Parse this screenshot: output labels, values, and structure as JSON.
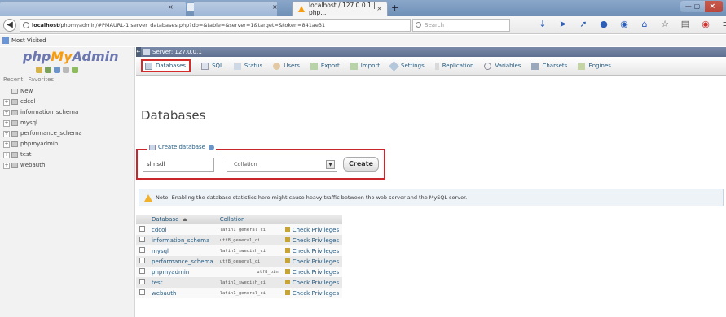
{
  "browser": {
    "active_tab_title": "localhost / 127.0.0.1 | php...",
    "tab_close": "×",
    "new_tab": "+",
    "url_host": "localhost",
    "url_rest": "/phpmyadmin/#PMAURL-1:server_databases.php?db=&table=&server=1&target=&token=841ae31",
    "search_placeholder": "Search",
    "bookmarks_label": "Most Visited",
    "win_close": "×",
    "win_minmax": "— ▢"
  },
  "sidebar": {
    "logo_php": "php",
    "logo_my": "My",
    "logo_admin": "Admin",
    "recent_label": "Recent",
    "favorites_label": "Favorites",
    "new_label": "New",
    "databases": [
      "cdcol",
      "information_schema",
      "mysql",
      "performance_schema",
      "phpmyadmin",
      "test",
      "webauth"
    ]
  },
  "server_bar": {
    "label": "Server: 127.0.0.1"
  },
  "tabs": [
    {
      "label": "Databases",
      "icon": "database-icon"
    },
    {
      "label": "SQL",
      "icon": "sql-icon"
    },
    {
      "label": "Status",
      "icon": "status-icon"
    },
    {
      "label": "Users",
      "icon": "users-icon"
    },
    {
      "label": "Export",
      "icon": "export-icon"
    },
    {
      "label": "Import",
      "icon": "import-icon"
    },
    {
      "label": "Settings",
      "icon": "settings-icon"
    },
    {
      "label": "Replication",
      "icon": "replication-icon"
    },
    {
      "label": "Variables",
      "icon": "variables-icon"
    },
    {
      "label": "Charsets",
      "icon": "charsets-icon"
    },
    {
      "label": "Engines",
      "icon": "engines-icon"
    }
  ],
  "main": {
    "page_title": "Databases",
    "create_legend": "Create database",
    "db_name_value": "slmsdl",
    "collation_value": "Collation",
    "create_button": "Create",
    "notice": "Note: Enabling the database statistics here might cause heavy traffic between the web server and the MySQL server."
  },
  "table": {
    "headers": {
      "database": "Database",
      "collation": "Collation"
    },
    "rows": [
      {
        "name": "cdcol",
        "collation": "latin1_general_ci",
        "action": "Check Privileges"
      },
      {
        "name": "information_schema",
        "collation": "utf8_general_ci",
        "action": "Check Privileges"
      },
      {
        "name": "mysql",
        "collation": "latin1_swedish_ci",
        "action": "Check Privileges"
      },
      {
        "name": "performance_schema",
        "collation": "utf8_general_ci",
        "action": "Check Privileges"
      },
      {
        "name": "phpmyadmin",
        "collation": "utf8_bin",
        "action": "Check Privileges"
      },
      {
        "name": "test",
        "collation": "latin1_swedish_ci",
        "action": "Check Privileges"
      },
      {
        "name": "webauth",
        "collation": "latin1_general_ci",
        "action": "Check Privileges"
      }
    ]
  },
  "colors": {
    "highlight_red": "#d42b2b",
    "link_blue": "#235a81",
    "logo_orange": "#f89c0e",
    "logo_blue": "#6c78af"
  }
}
